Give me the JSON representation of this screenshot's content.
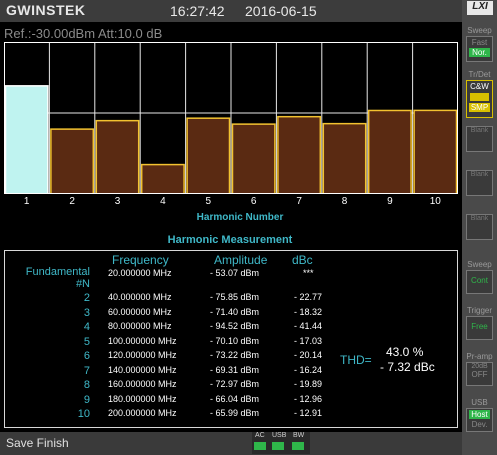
{
  "header": {
    "logo": "GWINSTEK",
    "time": "16:27:42",
    "date": "2016-06-15"
  },
  "ref_line": "Ref.:-30.00dBm  Att:10.0 dB",
  "chart_data": {
    "type": "bar",
    "title": "",
    "xlabel": "Harmonic Number",
    "categories": [
      "1",
      "2",
      "3",
      "4",
      "5",
      "6",
      "7",
      "8",
      "9",
      "10"
    ],
    "series": [
      {
        "values": [
          -53.07,
          -75.85,
          -71.4,
          -94.52,
          -70.1,
          -73.22,
          -69.31,
          -72.97,
          -66.04,
          -65.99
        ]
      }
    ],
    "colors": {
      "fundamental": "#bff3f0",
      "harmonic": "#5a2a12",
      "edge": "#f2c230"
    }
  },
  "measurement": {
    "title": "Harmonic Measurement",
    "headers": {
      "frequency": "Frequency",
      "amplitude": "Amplitude",
      "unit": "dBc"
    },
    "fundamental": {
      "label": "Fundamental",
      "freq": "20.000000  MHz",
      "amp": "- 53.07  dBm",
      "dbc": "***"
    },
    "n_label": "#N",
    "rows": [
      {
        "n": "2",
        "freq": "40.000000  MHz",
        "amp": "- 75.85  dBm",
        "dbc": "- 22.77"
      },
      {
        "n": "3",
        "freq": "60.000000  MHz",
        "amp": "- 71.40  dBm",
        "dbc": "- 18.32"
      },
      {
        "n": "4",
        "freq": "80.000000  MHz",
        "amp": "- 94.52  dBm",
        "dbc": "- 41.44"
      },
      {
        "n": "5",
        "freq": "100.000000  MHz",
        "amp": "- 70.10  dBm",
        "dbc": "- 17.03"
      },
      {
        "n": "6",
        "freq": "120.000000  MHz",
        "amp": "- 73.22  dBm",
        "dbc": "- 20.14"
      },
      {
        "n": "7",
        "freq": "140.000000  MHz",
        "amp": "- 69.31  dBm",
        "dbc": "- 16.24"
      },
      {
        "n": "8",
        "freq": "160.000000  MHz",
        "amp": "- 72.97  dBm",
        "dbc": "- 19.89"
      },
      {
        "n": "9",
        "freq": "180.000000  MHz",
        "amp": "- 66.04  dBm",
        "dbc": "- 12.96"
      },
      {
        "n": "10",
        "freq": "200.000000  MHz",
        "amp": "- 65.99  dBm",
        "dbc": "- 12.91"
      }
    ],
    "thd_label": "THD=",
    "thd_percent": "43.0  %",
    "thd_dbc": "- 7.32  dBc"
  },
  "footer": {
    "label": "Save Finish",
    "status": [
      "AC",
      "USB",
      "BW"
    ]
  },
  "right_panel": {
    "logo": "LXI",
    "sweep_label": "Sweep",
    "sweep_opts": [
      "Fast",
      "Nor."
    ],
    "trdet_label": "Tr/Det",
    "trdet_opts": [
      "C&W",
      "SMP"
    ],
    "blank1": "Blank",
    "blank2": "Blank",
    "blank3": "Blank",
    "sweep2_label": "Sweep",
    "sweep2_val": "Cont",
    "trigger_label": "Trigger",
    "trigger_val": "Free",
    "preamp_label": "Pr-amp",
    "preamp_val": "20dB",
    "preamp_state": "OFF",
    "usb_label": "USB",
    "usb_opts": [
      "Host",
      "Dev."
    ]
  }
}
